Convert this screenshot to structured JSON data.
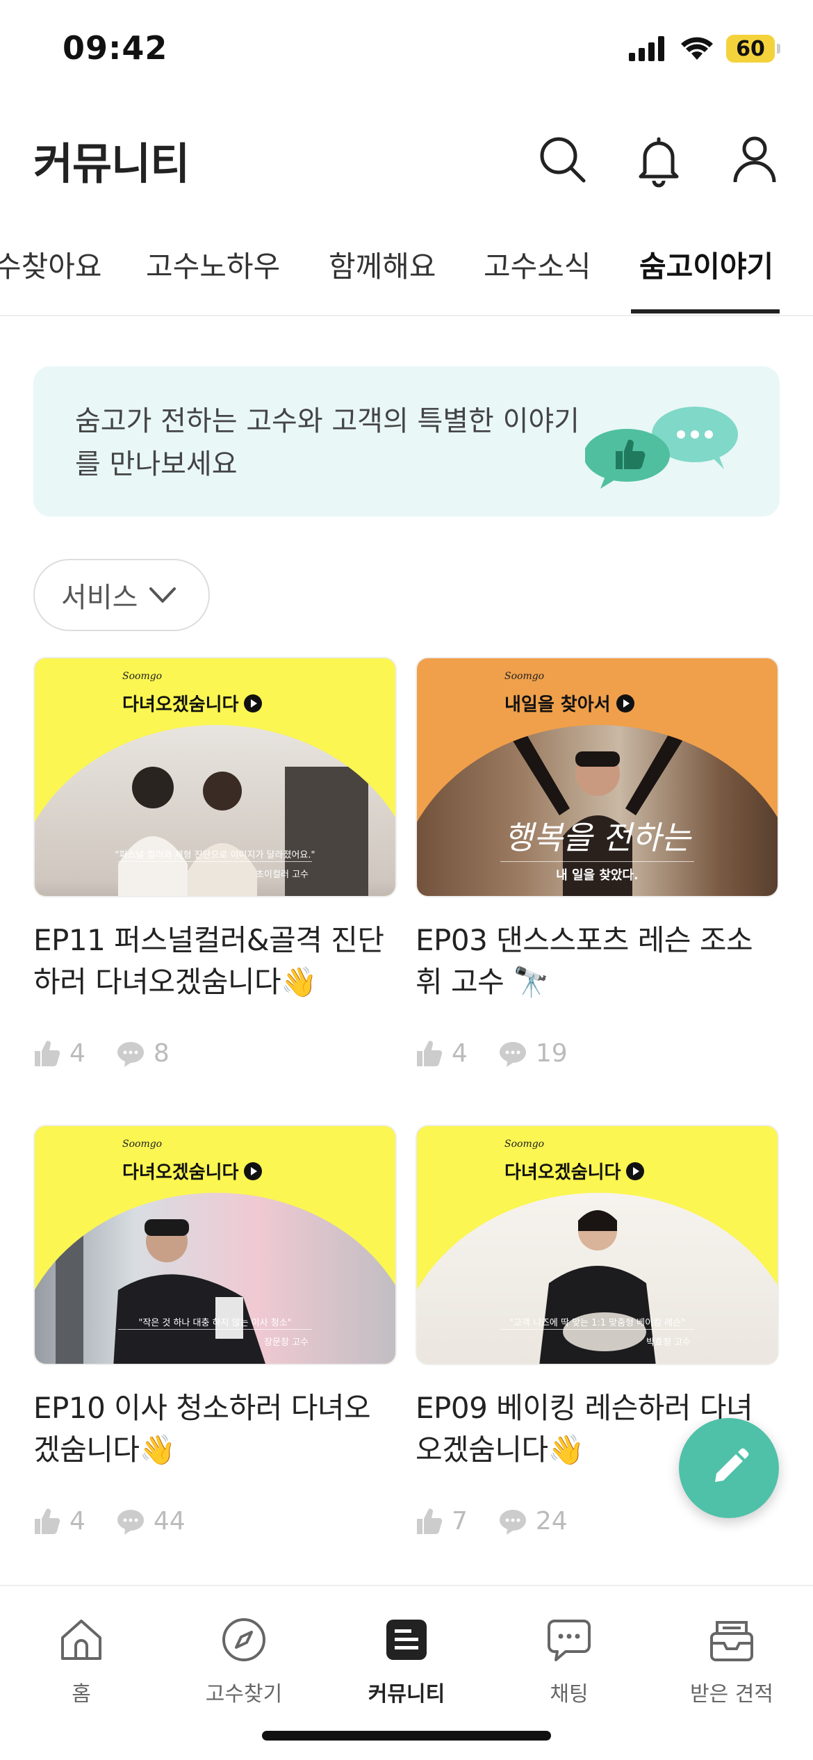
{
  "status_bar": {
    "time": "09:42",
    "battery": "60"
  },
  "header": {
    "title": "커뮤니티"
  },
  "tabs": [
    {
      "label": "수찾아요"
    },
    {
      "label": "고수노하우"
    },
    {
      "label": "함께해요"
    },
    {
      "label": "고수소식"
    },
    {
      "label": "숨고이야기",
      "active": true
    }
  ],
  "banner": {
    "text": "숨고가 전하는 고수와 고객의 특별한 이야기를 만나보세요"
  },
  "filter": {
    "label": "서비스"
  },
  "cards": [
    {
      "thumb_brand": "Soomgo",
      "thumb_title": "다녀오겠숨니다",
      "thumb_quote": "\"퍼스널 컬러와 체형 진단으로 이미지가 달라졌어요.\"",
      "thumb_credit": "초이컬러 고수",
      "title": "EP11 퍼스널컬러&골격 진단하러 다녀오겠숨니다👋",
      "likes": "4",
      "comments": "8"
    },
    {
      "thumb_brand": "Soomgo",
      "thumb_title": "내일을 찾아서",
      "thumb_script": "행복을 전하는",
      "thumb_caption": "내 일을 찾았다.",
      "title": "EP03 댄스스포츠 레슨 조소휘 고수 🔭",
      "likes": "4",
      "comments": "19"
    },
    {
      "thumb_brand": "Soomgo",
      "thumb_title": "다녀오겠숨니다",
      "thumb_quote": "\"작은 것 하나 대충 하지 않는 이사 청소\"",
      "thumb_credit": "장문창 고수",
      "title": "EP10 이사 청소하러 다녀오겠숨니다👋",
      "likes": "4",
      "comments": "44"
    },
    {
      "thumb_brand": "Soomgo",
      "thumb_title": "다녀오겠숨니다",
      "thumb_quote": "\"고객 니즈에 딱 맞는 1:1 맞춤형 베이킹 레슨\"",
      "thumb_credit": "박효정 고수",
      "title": "EP09 베이킹 레슨하러 다녀오겠숨니다👋",
      "likes": "7",
      "comments": "24"
    }
  ],
  "bottom_nav": [
    {
      "label": "홈",
      "icon": "home-icon"
    },
    {
      "label": "고수찾기",
      "icon": "compass-icon"
    },
    {
      "label": "커뮤니티",
      "icon": "community-icon",
      "active": true
    },
    {
      "label": "채팅",
      "icon": "chat-icon"
    },
    {
      "label": "받은 견적",
      "icon": "inbox-icon"
    }
  ],
  "colors": {
    "accent": "#4fc1a8",
    "banner_bg": "#e9f7f7",
    "thumb_yellow": "#fbf651",
    "thumb_orange": "#f0a04b"
  }
}
